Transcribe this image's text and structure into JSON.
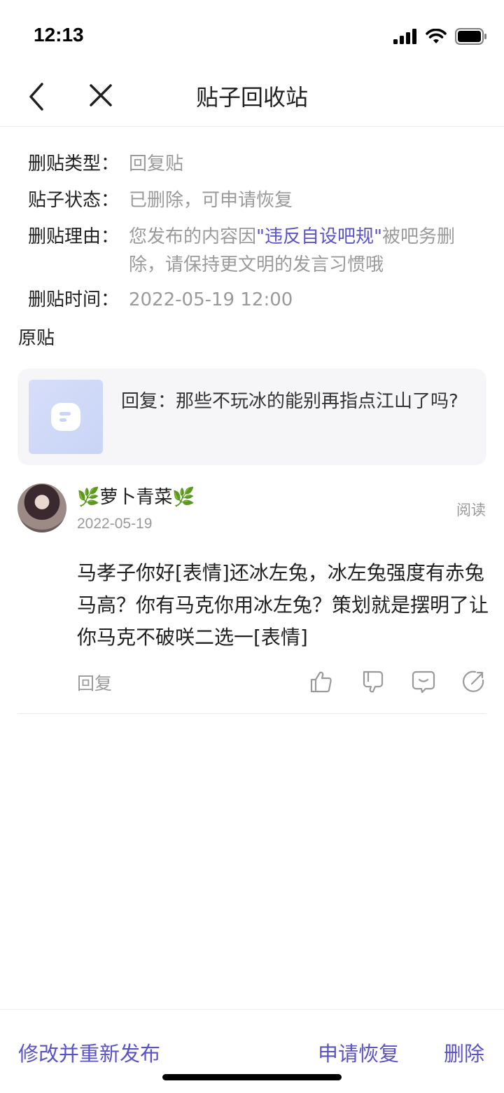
{
  "status_bar": {
    "time": "12:13"
  },
  "nav": {
    "title": "贴子回收站"
  },
  "info": {
    "type_label": "删贴类型：",
    "type_value": "回复贴",
    "status_label": "贴子状态：",
    "status_value": "已删除，可申请恢复",
    "reason_label": "删贴理由：",
    "reason_prefix": "您发布的内容因",
    "reason_highlight": "\"违反自设吧规\"",
    "reason_suffix": "被吧务删除，请保持更文明的发言习惯哦",
    "time_label": "删贴时间：",
    "time_value": "2022-05-19 12:00"
  },
  "original": {
    "section_title": "原贴",
    "text": "回复：那些不玩冰的能别再指点江山了吗?"
  },
  "comment": {
    "user_name": "🌿萝卜青菜🌿",
    "date": "2022-05-19",
    "read_label": "阅读",
    "text": " 马孝子你好[表情]还冰左兔，冰左兔强度有赤兔马高？你有马克你用冰左兔？策划就是摆明了让你马克不破咲二选一[表情]",
    "reply_label": "回复"
  },
  "bottom": {
    "edit_label": "修改并重新发布",
    "restore_label": "申请恢复",
    "delete_label": "删除"
  },
  "colors": {
    "accent": "#5a52c8",
    "muted": "#9a9a9a",
    "card_bg": "#f6f6f9"
  },
  "icons": [
    "signal-icon",
    "wifi-icon",
    "battery-icon",
    "back-arrow-icon",
    "close-icon",
    "post-icon",
    "like-icon",
    "dislike-icon",
    "comment-icon",
    "share-icon"
  ]
}
